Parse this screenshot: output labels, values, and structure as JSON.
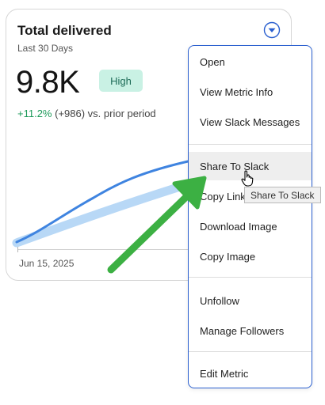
{
  "card": {
    "title": "Total delivered",
    "subtitle": "Last 30 Days",
    "value": "9.8K",
    "badge": "High",
    "delta_pct": "+11.2%",
    "delta_rest": "(+986) vs. prior period",
    "x_axis_start_label": "Jun 15, 2025"
  },
  "menu": {
    "items": [
      "Open",
      "View Metric Info",
      "View Slack Messages",
      "Share To Slack",
      "Copy Link",
      "Download Image",
      "Copy Image",
      "Unfollow",
      "Manage Followers",
      "Edit Metric"
    ],
    "hovered_item": "Share To Slack"
  },
  "tooltip": "Share To Slack",
  "colors": {
    "accent_blue": "#2a5fcf",
    "line_current": "#3f84e0",
    "line_prior": "#b8d8f6",
    "badge_bg": "#c9f1e4",
    "badge_text": "#1d6b57",
    "positive": "#1d9a5a",
    "annotation_arrow": "#3cb043"
  },
  "icons": {
    "menu_toggle": "chevron-down-circle-icon",
    "cursor": "hand-pointer-icon",
    "annotation": "arrow-up-right-icon"
  }
}
